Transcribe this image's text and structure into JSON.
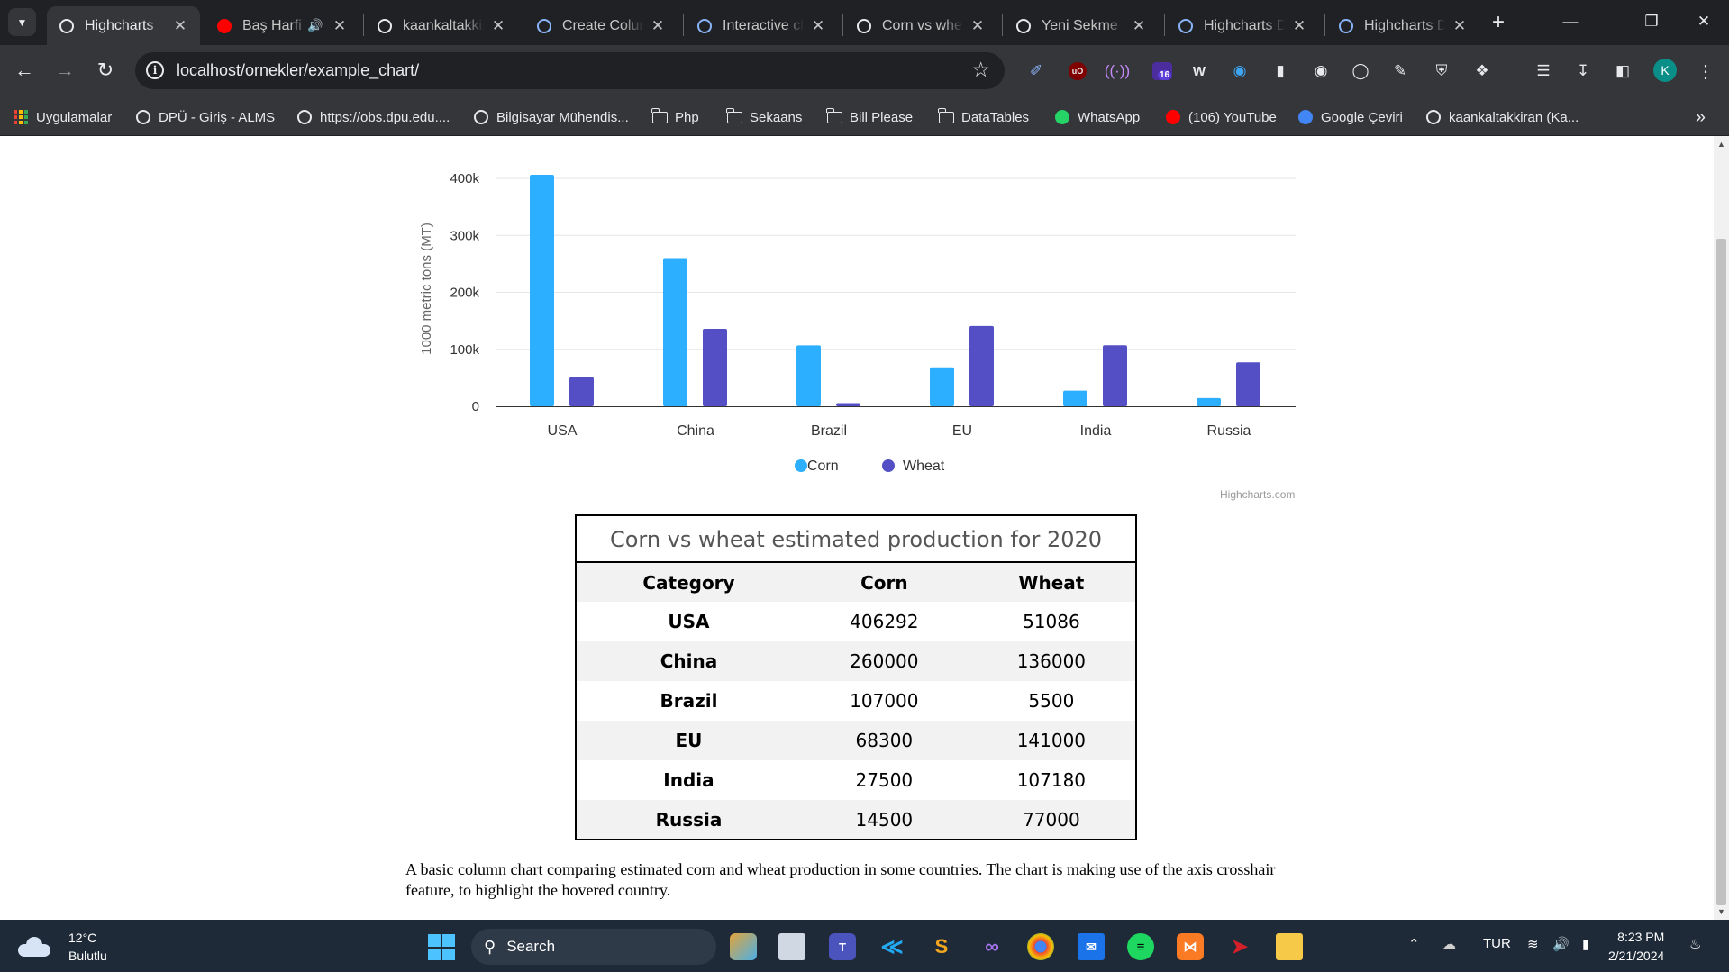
{
  "browser": {
    "tabs": [
      {
        "title": "Highcharts",
        "active": true,
        "icon": "globe-icon"
      },
      {
        "title": "Baş Harfi",
        "active": false,
        "icon": "youtube-music-icon",
        "audio": true
      },
      {
        "title": "kaankaltakkiran",
        "active": false,
        "icon": "github-icon"
      },
      {
        "title": "Create Column",
        "active": false,
        "icon": "highcharts-icon"
      },
      {
        "title": "Interactive charts",
        "active": false,
        "icon": "highcharts-icon"
      },
      {
        "title": "Corn vs wheat",
        "active": false,
        "icon": "codepen-icon"
      },
      {
        "title": "Yeni Sekme",
        "active": false,
        "icon": "chrome-icon"
      },
      {
        "title": "Highcharts Demo",
        "active": false,
        "icon": "highcharts-icon"
      },
      {
        "title": "Highcharts Demo",
        "active": false,
        "icon": "highcharts-icon"
      }
    ],
    "url": "localhost/ornekler/example_chart/",
    "extension_badge": "16",
    "profile_initial": "K",
    "bookmarks": [
      {
        "label": "Uygulamalar",
        "icon": "apps-grid-icon"
      },
      {
        "label": "DPÜ - Giriş - ALMS",
        "icon": "globe-icon"
      },
      {
        "label": "https://obs.dpu.edu....",
        "icon": "globe-icon"
      },
      {
        "label": "Bilgisayar Mühendis...",
        "icon": "site-icon"
      },
      {
        "label": "Php",
        "icon": "folder-icon"
      },
      {
        "label": "Sekaans",
        "icon": "folder-icon"
      },
      {
        "label": "Bill Please",
        "icon": "folder-icon"
      },
      {
        "label": "DataTables",
        "icon": "folder-icon"
      },
      {
        "label": "WhatsApp",
        "icon": "whatsapp-icon"
      },
      {
        "label": "(106) YouTube",
        "icon": "youtube-icon"
      },
      {
        "label": "Google Çeviri",
        "icon": "google-translate-icon"
      },
      {
        "label": "kaankaltakkiran (Ka...",
        "icon": "github-icon"
      }
    ]
  },
  "chart_data": {
    "type": "bar",
    "categories": [
      "USA",
      "China",
      "Brazil",
      "EU",
      "India",
      "Russia"
    ],
    "series": [
      {
        "name": "Corn",
        "color": "#2caffe",
        "values": [
          406292,
          260000,
          107000,
          68300,
          27500,
          14500
        ]
      },
      {
        "name": "Wheat",
        "color": "#544fc5",
        "values": [
          51086,
          136000,
          5500,
          141000,
          107180,
          77000
        ]
      }
    ],
    "ylabel": "1000 metric tons (MT)",
    "ylim": [
      0,
      400000
    ],
    "yticks": [
      "0",
      "100k",
      "200k",
      "300k",
      "400k"
    ],
    "legend": "bottom-center",
    "grid": true
  },
  "credits": "Highcharts.com",
  "table": {
    "caption": "Corn vs wheat estimated production for 2020",
    "headers": [
      "Category",
      "Corn",
      "Wheat"
    ],
    "rows": [
      [
        "USA",
        "406292",
        "51086"
      ],
      [
        "China",
        "260000",
        "136000"
      ],
      [
        "Brazil",
        "107000",
        "5500"
      ],
      [
        "EU",
        "68300",
        "141000"
      ],
      [
        "India",
        "27500",
        "107180"
      ],
      [
        "Russia",
        "14500",
        "77000"
      ]
    ]
  },
  "description": "A basic column chart comparing estimated corn and wheat production in some countries. The chart is making use of the axis crosshair feature, to highlight the hovered country.",
  "taskbar": {
    "weather_temp": "12°C",
    "weather_desc": "Bulutlu",
    "search_label": "Search",
    "language": "TUR",
    "time": "8:23 PM",
    "date": "2/21/2024"
  }
}
